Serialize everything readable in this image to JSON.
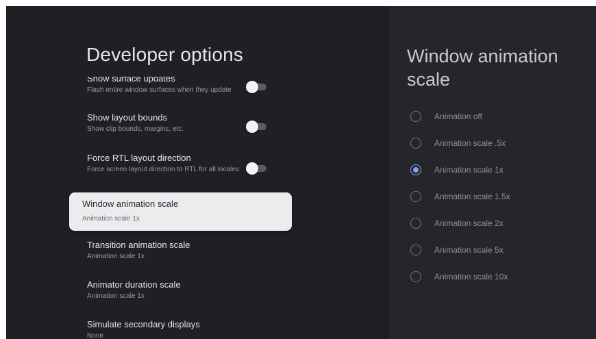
{
  "header": {
    "title": "Developer options"
  },
  "settings": [
    {
      "label": "Show surface updates",
      "sub": "Flash entire window surfaces when they update",
      "toggle": "off"
    },
    {
      "label": "Show layout bounds",
      "sub": "Show clip bounds, margins, etc.",
      "toggle": "off"
    },
    {
      "label": "Force RTL layout direction",
      "sub": "Force screen layout direction to RTL for all locales",
      "toggle": "off"
    },
    {
      "label": "Window animation scale",
      "sub": "Animation scale 1x",
      "focused": true
    },
    {
      "label": "Transition animation scale",
      "sub": "Animation scale 1x"
    },
    {
      "label": "Animator duration scale",
      "sub": "Animation scale 1x"
    },
    {
      "label": "Simulate secondary displays",
      "sub": "None"
    }
  ],
  "panel": {
    "title": "Window animation scale",
    "selected_index": 2,
    "options": [
      "Animation off",
      "Animation scale .5x",
      "Animation scale 1x",
      "Animation scale 1.5x",
      "Animation scale 2x",
      "Animation scale 5x",
      "Animation scale 10x"
    ]
  },
  "colors": {
    "background": "#1f2024",
    "panel_background": "#25262b",
    "accent": "#7aa7e6",
    "focused_card": "#ebecee"
  }
}
